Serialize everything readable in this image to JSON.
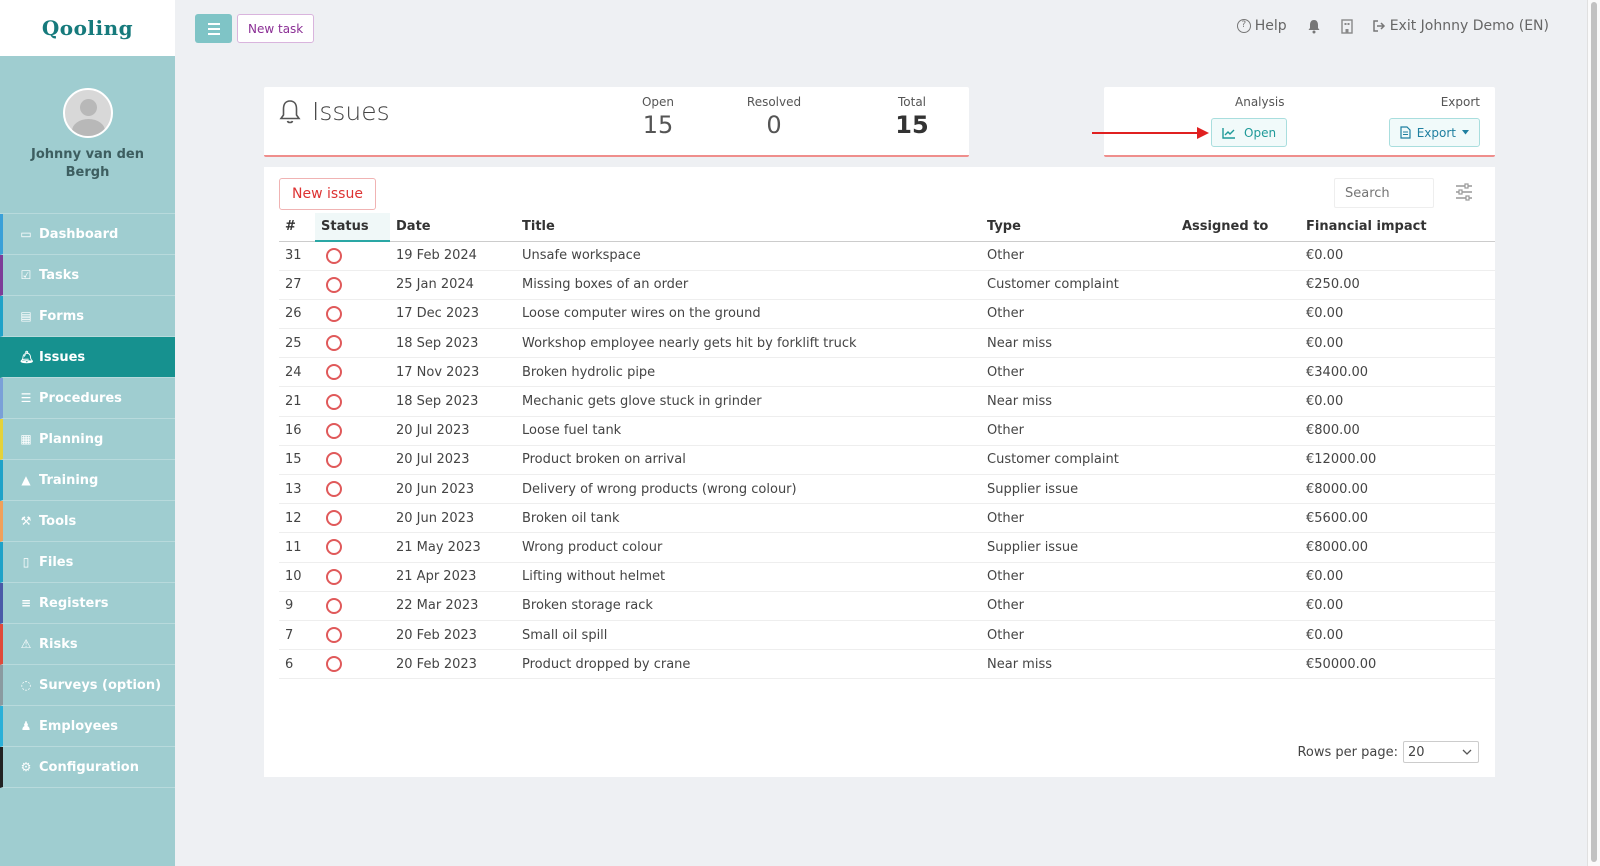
{
  "brand": {
    "logo_text": "Qooling"
  },
  "user": {
    "name": "Johnny van den Bergh"
  },
  "sidebar": {
    "items": [
      {
        "label": "Dashboard",
        "icon": "monitor-icon",
        "glyph": "▭",
        "accent": "#3aa0d8"
      },
      {
        "label": "Tasks",
        "icon": "check-square-icon",
        "glyph": "☑",
        "accent": "#7d3c98"
      },
      {
        "label": "Forms",
        "icon": "document-icon",
        "glyph": "▤",
        "accent": "#1fa2c8"
      },
      {
        "label": "Issues",
        "icon": "bell-icon",
        "glyph": "🔔︎",
        "accent": "#16918f",
        "active": true
      },
      {
        "label": "Procedures",
        "icon": "list-icon",
        "glyph": "☰",
        "accent": "#7aa0d8"
      },
      {
        "label": "Planning",
        "icon": "calendar-icon",
        "glyph": "▦",
        "accent": "#e4d23a"
      },
      {
        "label": "Training",
        "icon": "graduation-cap-icon",
        "glyph": "▲",
        "accent": "#1fa2c8"
      },
      {
        "label": "Tools",
        "icon": "wrench-icon",
        "glyph": "⚒",
        "accent": "#f0a05a"
      },
      {
        "label": "Files",
        "icon": "file-icon",
        "glyph": "▯",
        "accent": "#1fa2c8"
      },
      {
        "label": "Registers",
        "icon": "menu-lines-icon",
        "glyph": "≡",
        "accent": "#4a5aa8"
      },
      {
        "label": "Risks",
        "icon": "warning-icon",
        "glyph": "⚠",
        "accent": "#e04a3a"
      },
      {
        "label": "Surveys (option)",
        "icon": "speech-bubble-icon",
        "glyph": "◌",
        "accent": "#8a9aa0"
      },
      {
        "label": "Employees",
        "icon": "users-icon",
        "glyph": "♟",
        "accent": "#2ab0d8"
      },
      {
        "label": "Configuration",
        "icon": "gear-icon",
        "glyph": "⚙",
        "accent": "#222222"
      }
    ]
  },
  "topbar": {
    "new_task_label": "New task",
    "help_label": "Help",
    "exit_label": "Exit Johnny Demo (EN)"
  },
  "summary": {
    "title": "Issues",
    "open_label": "Open",
    "open_value": "15",
    "resolved_label": "Resolved",
    "resolved_value": "0",
    "total_label": "Total",
    "total_value": "15"
  },
  "analysis": {
    "analysis_label": "Analysis",
    "open_button": "Open",
    "export_label": "Export",
    "export_button": "Export"
  },
  "toolbar": {
    "new_issue_label": "New issue",
    "search_placeholder": "Search"
  },
  "table": {
    "columns": [
      "#",
      "Status",
      "Date",
      "Title",
      "Type",
      "Assigned to",
      "Financial impact"
    ],
    "rows": [
      {
        "id": "31",
        "date": "19 Feb 2024",
        "title": "Unsafe workspace",
        "type": "Other",
        "assigned": "",
        "impact": "€0.00"
      },
      {
        "id": "27",
        "date": "25 Jan 2024",
        "title": "Missing boxes of an order",
        "type": "Customer complaint",
        "assigned": "",
        "impact": "€250.00"
      },
      {
        "id": "26",
        "date": "17 Dec 2023",
        "title": "Loose computer wires on the ground",
        "type": "Other",
        "assigned": "",
        "impact": "€0.00"
      },
      {
        "id": "25",
        "date": "18 Sep 2023",
        "title": "Workshop employee nearly gets hit by forklift truck",
        "type": "Near miss",
        "assigned": "",
        "impact": "€0.00"
      },
      {
        "id": "24",
        "date": "17 Nov 2023",
        "title": "Broken hydrolic pipe",
        "type": "Other",
        "assigned": "",
        "impact": "€3400.00"
      },
      {
        "id": "21",
        "date": "18 Sep 2023",
        "title": "Mechanic gets glove stuck in grinder",
        "type": "Near miss",
        "assigned": "",
        "impact": "€0.00"
      },
      {
        "id": "16",
        "date": "20 Jul 2023",
        "title": "Loose fuel tank",
        "type": "Other",
        "assigned": "",
        "impact": "€800.00"
      },
      {
        "id": "15",
        "date": "20 Jul 2023",
        "title": "Product broken on arrival",
        "type": "Customer complaint",
        "assigned": "",
        "impact": "€12000.00"
      },
      {
        "id": "13",
        "date": "20 Jun 2023",
        "title": "Delivery of wrong products (wrong colour)",
        "type": "Supplier issue",
        "assigned": "",
        "impact": "€8000.00"
      },
      {
        "id": "12",
        "date": "20 Jun 2023",
        "title": "Broken oil tank",
        "type": "Other",
        "assigned": "",
        "impact": "€5600.00"
      },
      {
        "id": "11",
        "date": "21 May 2023",
        "title": "Wrong product colour",
        "type": "Supplier issue",
        "assigned": "",
        "impact": "€8000.00"
      },
      {
        "id": "10",
        "date": "21 Apr 2023",
        "title": "Lifting without helmet",
        "type": "Other",
        "assigned": "",
        "impact": "€0.00"
      },
      {
        "id": "9",
        "date": "22 Mar 2023",
        "title": "Broken storage rack",
        "type": "Other",
        "assigned": "",
        "impact": "€0.00"
      },
      {
        "id": "7",
        "date": "20 Feb 2023",
        "title": "Small oil spill",
        "type": "Other",
        "assigned": "",
        "impact": "€0.00"
      },
      {
        "id": "6",
        "date": "20 Feb 2023",
        "title": "Product dropped by crane",
        "type": "Near miss",
        "assigned": "",
        "impact": "€50000.00"
      }
    ]
  },
  "pagination": {
    "rows_per_page_label": "Rows per page:",
    "rows_per_page_value": "20"
  },
  "colors": {
    "brand_teal": "#16918f",
    "sidebar_bg": "#9fcdd0",
    "status_open": "#e0595a",
    "annotation_arrow": "#e02020"
  }
}
